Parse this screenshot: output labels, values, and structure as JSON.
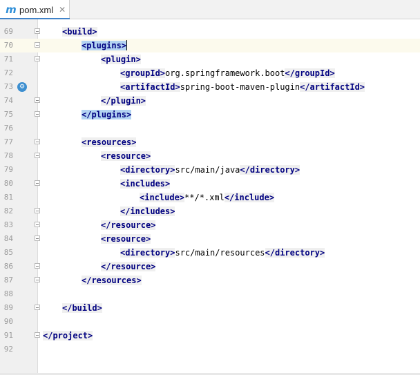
{
  "tab": {
    "icon": "maven-m-icon",
    "icon_glyph": "m",
    "label": "pom.xml",
    "close_glyph": "✕"
  },
  "gutter_marker": {
    "icon": "spring-bean-icon",
    "glyph": "⚙"
  },
  "lines": [
    {
      "num": "69",
      "tokens": [
        {
          "t": "tag",
          "v": "<build>"
        }
      ]
    },
    {
      "num": "70",
      "current": true,
      "tokens": [
        {
          "t": "tagsel",
          "v": "<plugins>"
        }
      ]
    },
    {
      "num": "71",
      "tokens": [
        {
          "t": "tag",
          "v": "<plugin>"
        }
      ]
    },
    {
      "num": "72",
      "tokens": [
        {
          "t": "tag",
          "v": "<groupId>"
        },
        {
          "t": "text",
          "v": "org.springframework.boot"
        },
        {
          "t": "tag",
          "v": "</groupId>"
        }
      ]
    },
    {
      "num": "73",
      "tokens": [
        {
          "t": "tag",
          "v": "<artifactId>"
        },
        {
          "t": "text",
          "v": "spring-boot-maven-plugin"
        },
        {
          "t": "tag",
          "v": "</artifactId>"
        }
      ]
    },
    {
      "num": "74",
      "tokens": [
        {
          "t": "tag",
          "v": "</plugin>"
        }
      ]
    },
    {
      "num": "75",
      "tokens": [
        {
          "t": "tagsel",
          "v": "</plugins>"
        }
      ]
    },
    {
      "num": "76",
      "tokens": []
    },
    {
      "num": "77",
      "tokens": [
        {
          "t": "tag",
          "v": "<resources>"
        }
      ]
    },
    {
      "num": "78",
      "tokens": [
        {
          "t": "tag",
          "v": "<resource>"
        }
      ]
    },
    {
      "num": "79",
      "tokens": [
        {
          "t": "tag",
          "v": "<directory>"
        },
        {
          "t": "text",
          "v": "src/main/java"
        },
        {
          "t": "tag",
          "v": "</directory>"
        }
      ]
    },
    {
      "num": "80",
      "tokens": [
        {
          "t": "tag",
          "v": "<includes>"
        }
      ]
    },
    {
      "num": "81",
      "tokens": [
        {
          "t": "tag",
          "v": "<include>"
        },
        {
          "t": "text",
          "v": "**/*.xml"
        },
        {
          "t": "tag",
          "v": "</include>"
        }
      ]
    },
    {
      "num": "82",
      "tokens": [
        {
          "t": "tag",
          "v": "</includes>"
        }
      ]
    },
    {
      "num": "83",
      "tokens": [
        {
          "t": "tag",
          "v": "</resource>"
        }
      ]
    },
    {
      "num": "84",
      "tokens": [
        {
          "t": "tag",
          "v": "<resource>"
        }
      ]
    },
    {
      "num": "85",
      "tokens": [
        {
          "t": "tag",
          "v": "<directory>"
        },
        {
          "t": "text",
          "v": "src/main/resources"
        },
        {
          "t": "tag",
          "v": "</directory>"
        }
      ]
    },
    {
      "num": "86",
      "tokens": [
        {
          "t": "tag",
          "v": "</resource>"
        }
      ]
    },
    {
      "num": "87",
      "tokens": [
        {
          "t": "tag",
          "v": "</resources>"
        }
      ]
    },
    {
      "num": "88",
      "tokens": []
    },
    {
      "num": "89",
      "tokens": [
        {
          "t": "tag",
          "v": "</build>"
        }
      ]
    },
    {
      "num": "90",
      "tokens": []
    },
    {
      "num": "91",
      "tokens": [
        {
          "t": "tag",
          "v": "</project>"
        }
      ]
    },
    {
      "num": "92",
      "tokens": []
    }
  ]
}
